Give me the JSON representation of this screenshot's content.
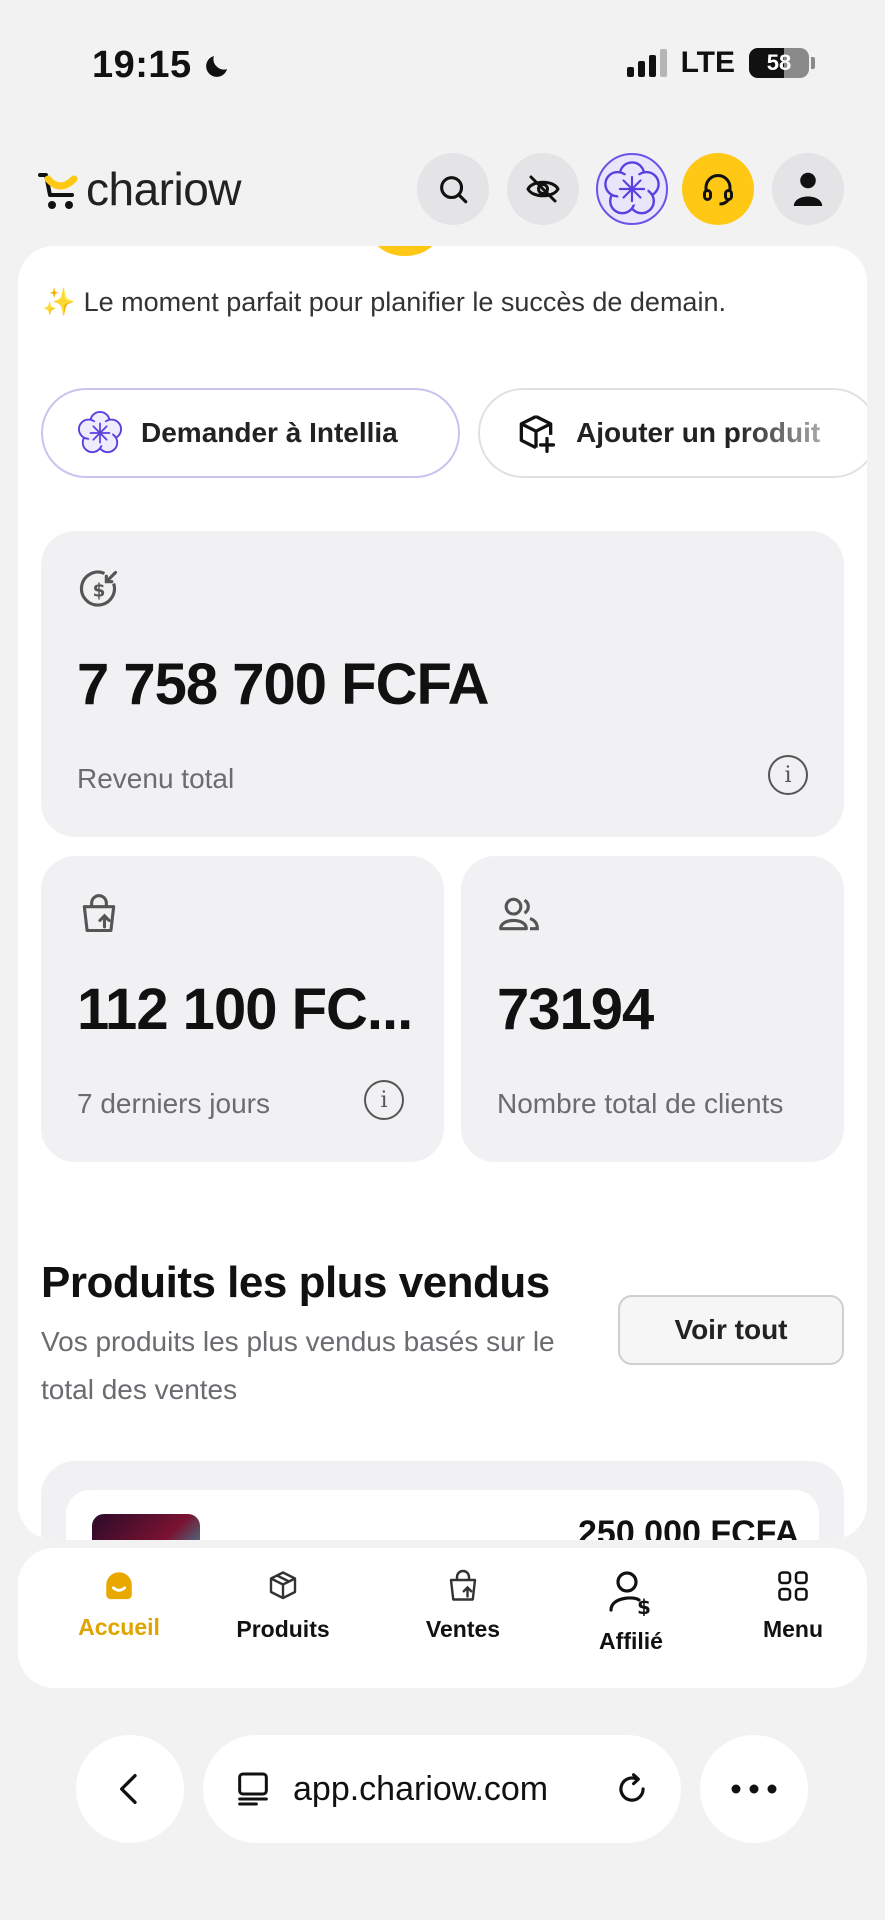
{
  "status_bar": {
    "time": "19:15",
    "network": "LTE",
    "battery": "58"
  },
  "header": {
    "logo_text": "chariow",
    "buttons": [
      "search-icon",
      "eye-off-icon",
      "intellia-icon",
      "headset-icon",
      "user-icon"
    ],
    "colors": {
      "accent": "#FFC814",
      "ai": "#5B3FE0"
    }
  },
  "tip": {
    "emoji": "✨",
    "text": "Le moment parfait pour planifier le succès de demain."
  },
  "quick_actions": [
    {
      "label": "Demander à Intellia",
      "icon": "intellia-icon"
    },
    {
      "label": "Ajouter un produit",
      "icon": "box-plus-icon"
    }
  ],
  "stats": {
    "total_revenue": {
      "value": "7 758 700 FCFA",
      "label": "Revenu total"
    },
    "last_7_days": {
      "value": "112 100 FC...",
      "label": "7 derniers jours"
    },
    "total_clients": {
      "value": "73194",
      "label": "Nombre total de clients"
    }
  },
  "top_products": {
    "title": "Produits les plus vendus",
    "subtitle": "Vos produits les plus vendus basés sur le total des ventes",
    "see_all": "Voir tout",
    "first_price": "250 000 FCFA"
  },
  "bottom_nav": [
    {
      "label": "Accueil",
      "icon": "home-icon",
      "active": true
    },
    {
      "label": "Produits",
      "icon": "box-icon",
      "active": false
    },
    {
      "label": "Ventes",
      "icon": "bag-icon",
      "active": false
    },
    {
      "label": "Affilié",
      "icon": "affiliate-icon",
      "active": false
    },
    {
      "label": "Menu",
      "icon": "grid-icon",
      "active": false
    }
  ],
  "browser": {
    "url": "app.chariow.com"
  }
}
